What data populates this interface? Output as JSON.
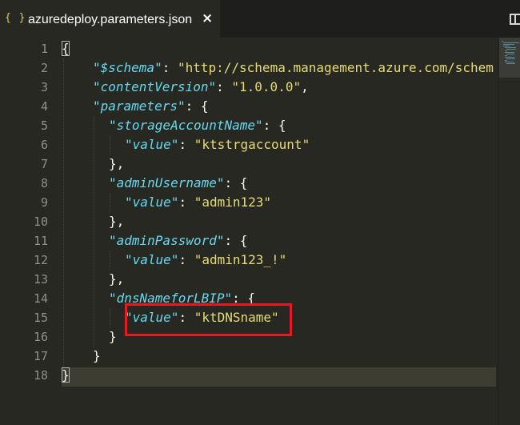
{
  "tab": {
    "icon": "{ }",
    "title": "azuredeploy.parameters.json",
    "close": "×"
  },
  "icons": {
    "tab_file_icon": "json-braces-icon",
    "split_editor": "split-editor-icon"
  },
  "colors": {
    "background": "#272822",
    "key": "#66d9ef",
    "string": "#e6db74",
    "punctuation": "#f8f8f2",
    "annotation_box": "#e51b24"
  },
  "line_numbers": [
    "1",
    "2",
    "3",
    "4",
    "5",
    "6",
    "7",
    "8",
    "9",
    "10",
    "11",
    "12",
    "13",
    "14",
    "15",
    "16",
    "17",
    "18"
  ],
  "code": {
    "l1": {
      "open": "{"
    },
    "l2": {
      "key": "\"$schema\"",
      "sep": ": ",
      "value": "\"http://schema.management.azure.com/schem"
    },
    "l3": {
      "key": "\"contentVersion\"",
      "sep": ": ",
      "value": "\"1.0.0.0\"",
      "end": ","
    },
    "l4": {
      "key": "\"parameters\"",
      "sep": ": {"
    },
    "l5": {
      "key": "\"storageAccountName\"",
      "sep": ": {"
    },
    "l6": {
      "key": "\"value\"",
      "sep": ": ",
      "value": "\"ktstrgaccount\""
    },
    "l7": {
      "close": "},"
    },
    "l8": {
      "key": "\"adminUsername\"",
      "sep": ": {"
    },
    "l9": {
      "key": "\"value\"",
      "sep": ": ",
      "value": "\"admin123\""
    },
    "l10": {
      "close": "},"
    },
    "l11": {
      "key": "\"adminPassword\"",
      "sep": ": {"
    },
    "l12": {
      "key": "\"value\"",
      "sep": ": ",
      "value": "\"admin123_!\""
    },
    "l13": {
      "close": "},"
    },
    "l14": {
      "key": "\"dnsNameforLBIP\"",
      "sep": ": {"
    },
    "l15": {
      "key": "\"value\"",
      "sep": ": ",
      "value": "\"ktDNSname\""
    },
    "l16": {
      "close": "}"
    },
    "l17": {
      "close": "}"
    },
    "l18": {
      "close": "}"
    }
  }
}
